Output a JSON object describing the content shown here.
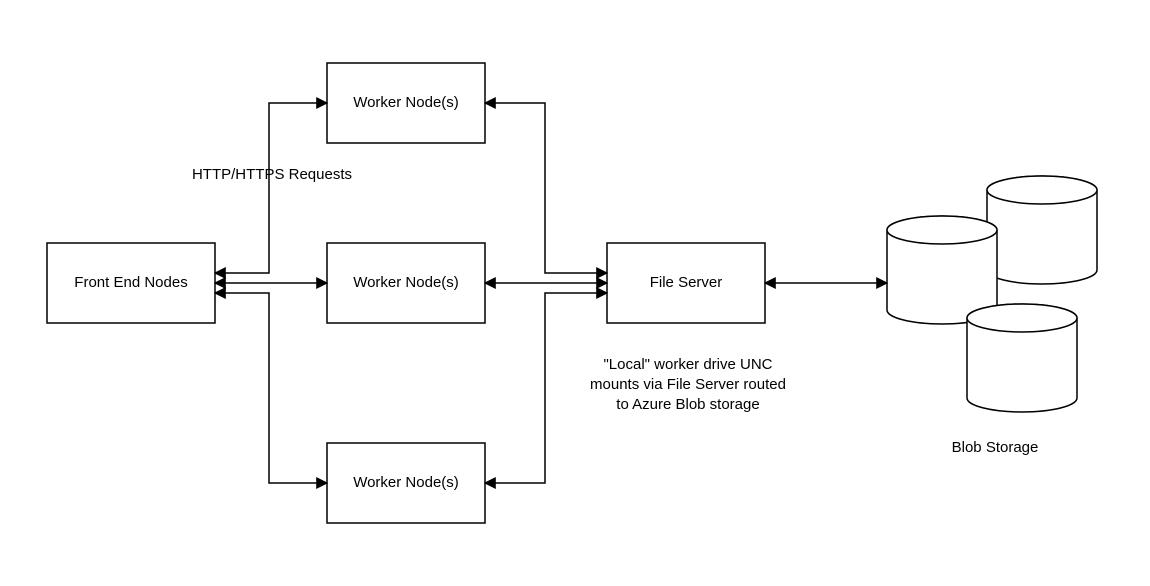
{
  "nodes": {
    "front_end": "Front End Nodes",
    "worker_top": "Worker Node(s)",
    "worker_mid": "Worker Node(s)",
    "worker_bot": "Worker Node(s)",
    "file_server": "File Server"
  },
  "labels": {
    "requests": "HTTP/HTTPS Requests",
    "unc_line1": "\"Local\" worker drive UNC",
    "unc_line2": "mounts via File Server routed",
    "unc_line3": "to Azure Blob storage",
    "blob": "Blob Storage"
  }
}
